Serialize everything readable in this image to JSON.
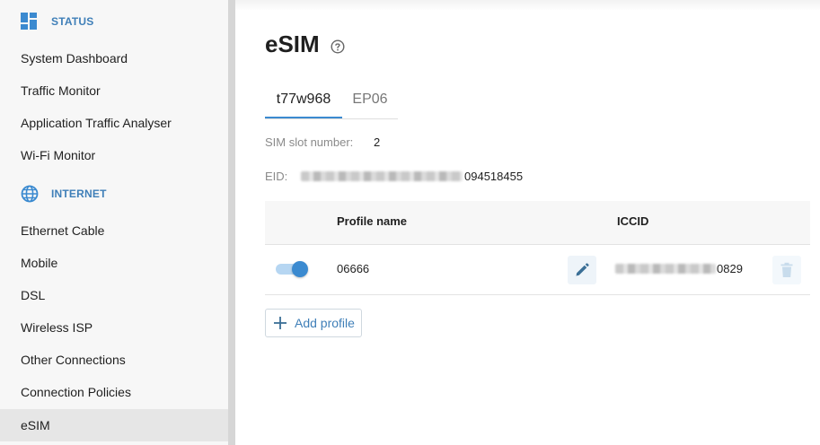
{
  "sidebar": {
    "sections": [
      {
        "label": "STATUS",
        "icon": "dashboard-icon"
      },
      {
        "label": "INTERNET",
        "icon": "globe-icon"
      }
    ],
    "status_items": [
      "System Dashboard",
      "Traffic Monitor",
      "Application Traffic Analyser",
      "Wi-Fi Monitor"
    ],
    "internet_items": [
      "Ethernet Cable",
      "Mobile",
      "DSL",
      "Wireless ISP",
      "Other Connections",
      "Connection Policies",
      "eSIM"
    ],
    "active_item": "eSIM"
  },
  "page": {
    "title": "eSIM",
    "tabs": [
      "t77w968",
      "EP06"
    ],
    "active_tab": "t77w968",
    "sim_slot_label": "SIM slot number:",
    "sim_slot_value": "2",
    "eid_label": "EID:",
    "eid_visible_suffix": "094518455",
    "table": {
      "columns": [
        "Profile name",
        "ICCID"
      ],
      "rows": [
        {
          "enabled": true,
          "profile_name": "06666",
          "iccid_visible_suffix": "0829"
        }
      ]
    },
    "add_profile_label": "Add profile"
  },
  "colors": {
    "accent": "#3b8ad0",
    "section_label": "#3f7fb8",
    "sidebar_bg": "#f7f7f7",
    "active_bg": "#e6e6e6"
  }
}
